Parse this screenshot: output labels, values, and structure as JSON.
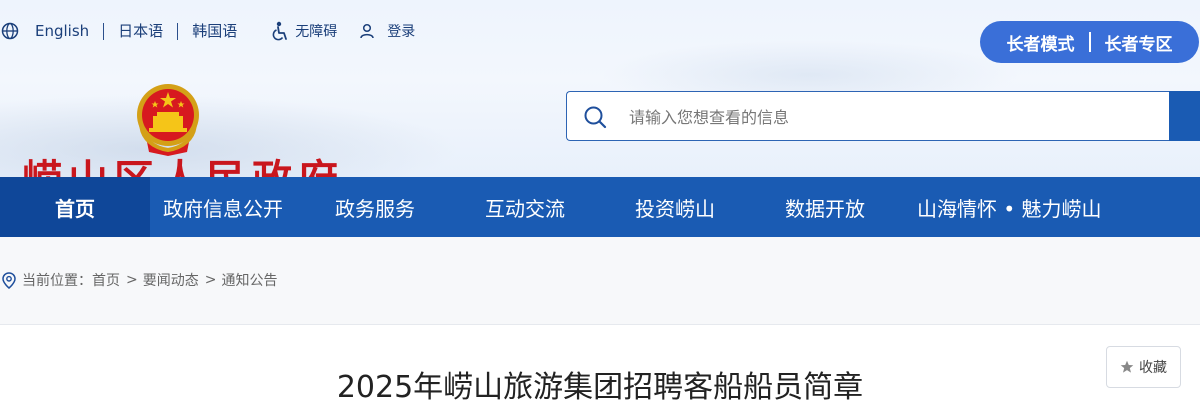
{
  "header": {
    "languages": [
      "English",
      "日本语",
      "韩国语"
    ],
    "accessibility_label": "无障碍",
    "login_label": "登录",
    "elder_mode_label": "长者模式",
    "elder_zone_label": "长者专区",
    "site_name": "崂山区人民政府"
  },
  "search": {
    "placeholder": "请输入您想查看的信息"
  },
  "nav": {
    "items": [
      {
        "label": "首页"
      },
      {
        "label": "政府信息公开"
      },
      {
        "label": "政务服务"
      },
      {
        "label": "互动交流"
      },
      {
        "label": "投资崂山"
      },
      {
        "label": "数据开放"
      },
      {
        "label": "山海情怀 • 魅力崂山"
      }
    ]
  },
  "breadcrumb": {
    "prefix": "当前位置：",
    "items": [
      "首页",
      "要闻动态",
      "通知公告"
    ]
  },
  "article": {
    "favorite_label": "收藏",
    "title": "2025年崂山旅游集团招聘客船船员简章"
  },
  "colors": {
    "nav_bg": "#1a5bb3",
    "nav_active_bg": "#0f4799",
    "elder_button_bg": "#3a6fd8",
    "site_name_red": "#c9161d"
  },
  "icons": [
    "globe-icon",
    "accessibility-icon",
    "user-icon",
    "national-emblem",
    "search-icon",
    "location-pin-icon",
    "star-icon"
  ]
}
